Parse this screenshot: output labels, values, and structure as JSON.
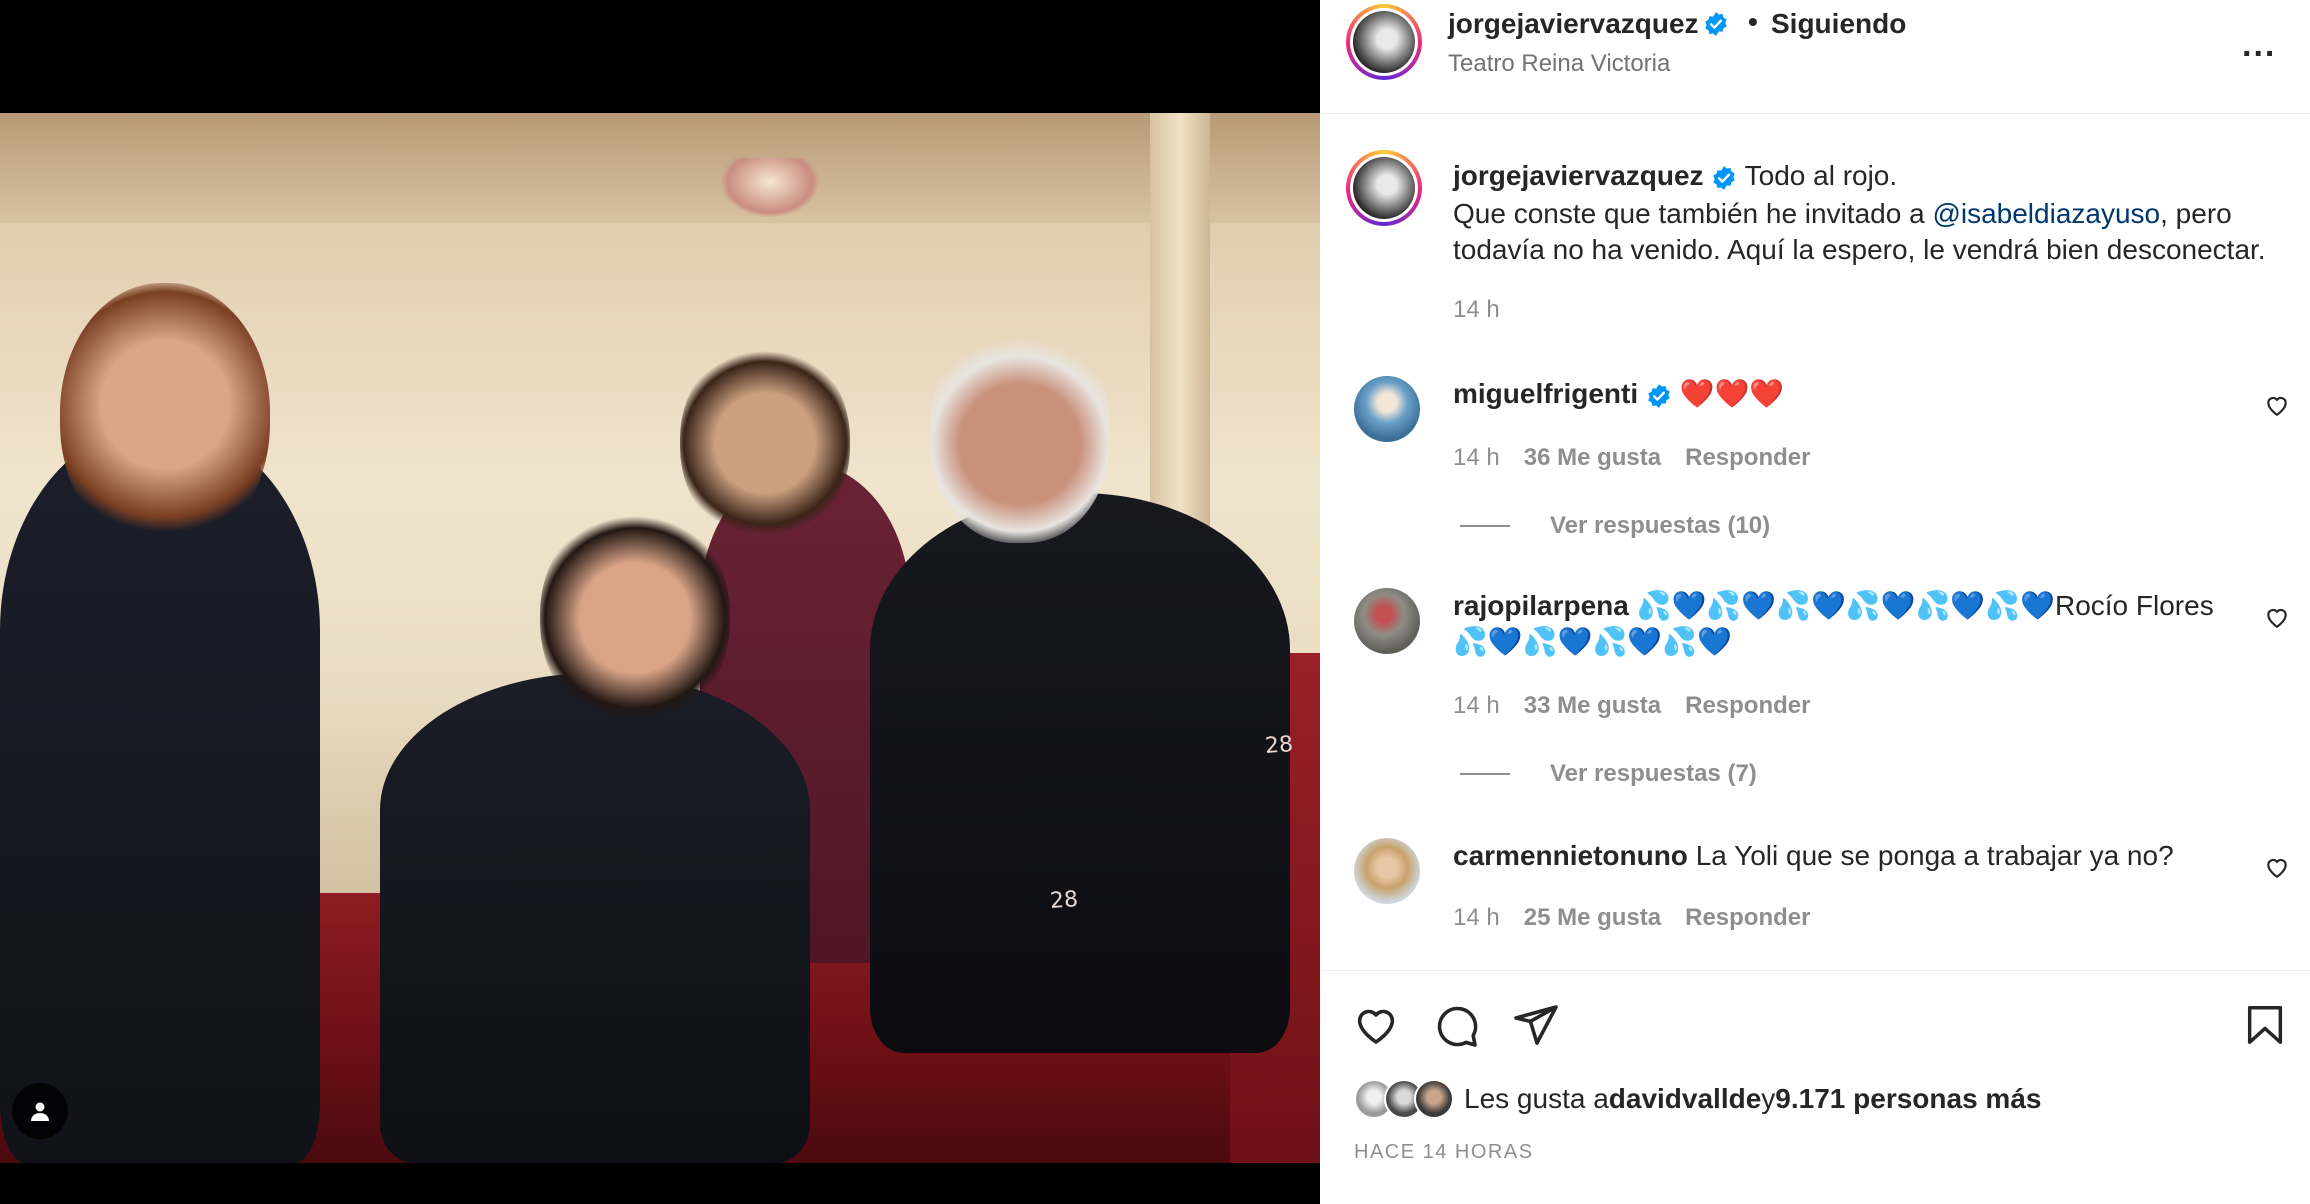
{
  "post": {
    "image_alt": "Four people posing in theater seats",
    "seat_number_1": "28",
    "seat_number_2": "28"
  },
  "header": {
    "username": "jorgejaviervazquez",
    "separator": "•",
    "follow_status": "Siguiendo",
    "location": "Teatro Reina Victoria",
    "more_label": "..."
  },
  "caption": {
    "username": "jorgejaviervazquez",
    "line1": "Todo al rojo.",
    "text_before_mention": "Que conste que también he invitado a ",
    "mention": "@isabeldiazayuso",
    "text_after_mention": ", pero todavía no ha venido. Aquí la espero, le vendrá bien desconectar.",
    "time": "14 h"
  },
  "comments": [
    {
      "username": "miguelfrigenti",
      "verified": true,
      "text": "❤️❤️❤️",
      "time": "14 h",
      "likes": "36 Me gusta",
      "reply": "Responder",
      "view_replies": "Ver respuestas (10)"
    },
    {
      "username": "rajopilarpena",
      "verified": false,
      "text_prefix": "💦💙💦💙💦💙💦💙💦💙💦💙",
      "text_name": "Rocío Flores ",
      "text_suffix": "💦💙💦💙💦💙💦💙",
      "time": "14 h",
      "likes": "33 Me gusta",
      "reply": "Responder",
      "view_replies": "Ver respuestas (7)"
    },
    {
      "username": "carmennietonuno",
      "verified": false,
      "text": "La Yoli que se ponga a trabajar ya no?",
      "time": "14 h",
      "likes": "25 Me gusta",
      "reply": "Responder"
    }
  ],
  "actions": {
    "likes_prefix": "Les gusta a ",
    "likes_user": "davidvallde",
    "likes_middle": " y ",
    "likes_count": "9.171 personas más",
    "ago": "HACE 14 HORAS"
  },
  "colors": {
    "verified": "#0095f6",
    "mention": "#00376b",
    "muted": "#8e8e8e"
  }
}
